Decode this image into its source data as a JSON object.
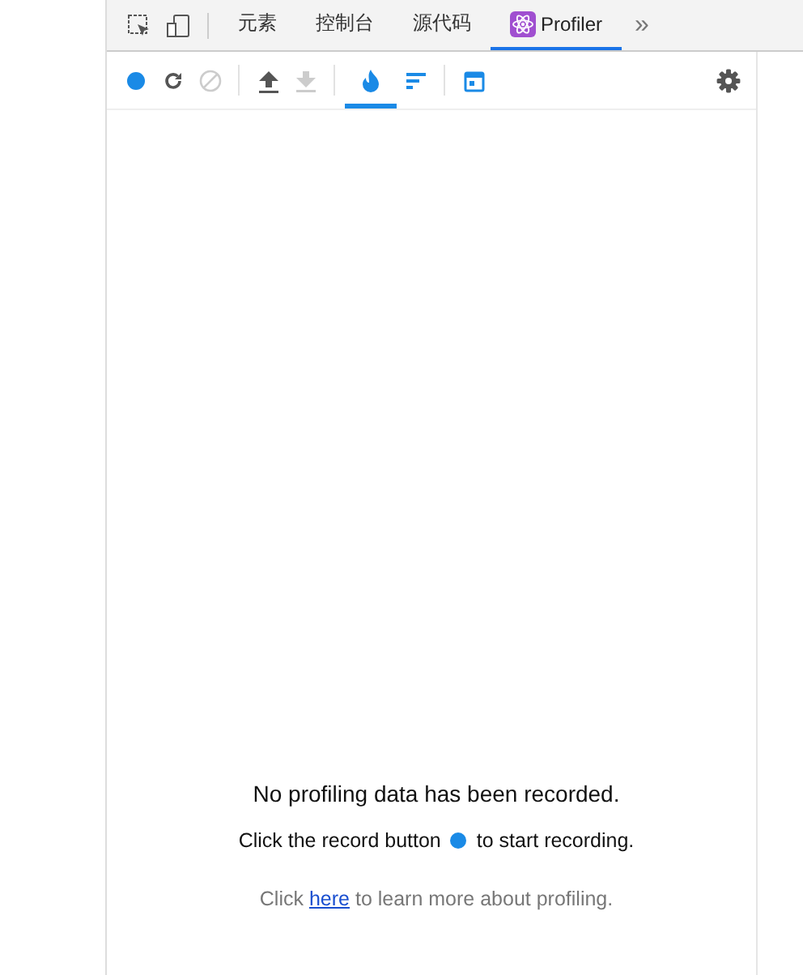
{
  "devtools_tabs": [
    {
      "kind": "inspect"
    },
    {
      "kind": "device"
    },
    {
      "kind": "text",
      "label": "元素",
      "selected": false
    },
    {
      "kind": "text",
      "label": "控制台",
      "selected": false
    },
    {
      "kind": "text",
      "label": "源代码",
      "selected": false
    },
    {
      "kind": "profiler",
      "label": "Profiler",
      "selected": true
    }
  ],
  "more_tabs": "»",
  "toolbar": [
    {
      "kind": "record",
      "disabled": false,
      "selected": false
    },
    {
      "kind": "reload",
      "disabled": false,
      "selected": false
    },
    {
      "kind": "clear",
      "disabled": true,
      "selected": false
    },
    {
      "kind": "sep"
    },
    {
      "kind": "upload",
      "disabled": false,
      "selected": false
    },
    {
      "kind": "download",
      "disabled": true,
      "selected": false
    },
    {
      "kind": "sep"
    },
    {
      "kind": "flame",
      "disabled": false,
      "selected": true
    },
    {
      "kind": "ranked",
      "disabled": false,
      "selected": false
    },
    {
      "kind": "sep"
    },
    {
      "kind": "timeline",
      "disabled": false,
      "selected": false
    }
  ],
  "empty": {
    "title": "No profiling data has been recorded.",
    "hint_before": "Click the record button",
    "hint_after": "to start recording.",
    "learn_before": "Click",
    "learn_link": "here",
    "learn_after": "to learn more about profiling."
  }
}
